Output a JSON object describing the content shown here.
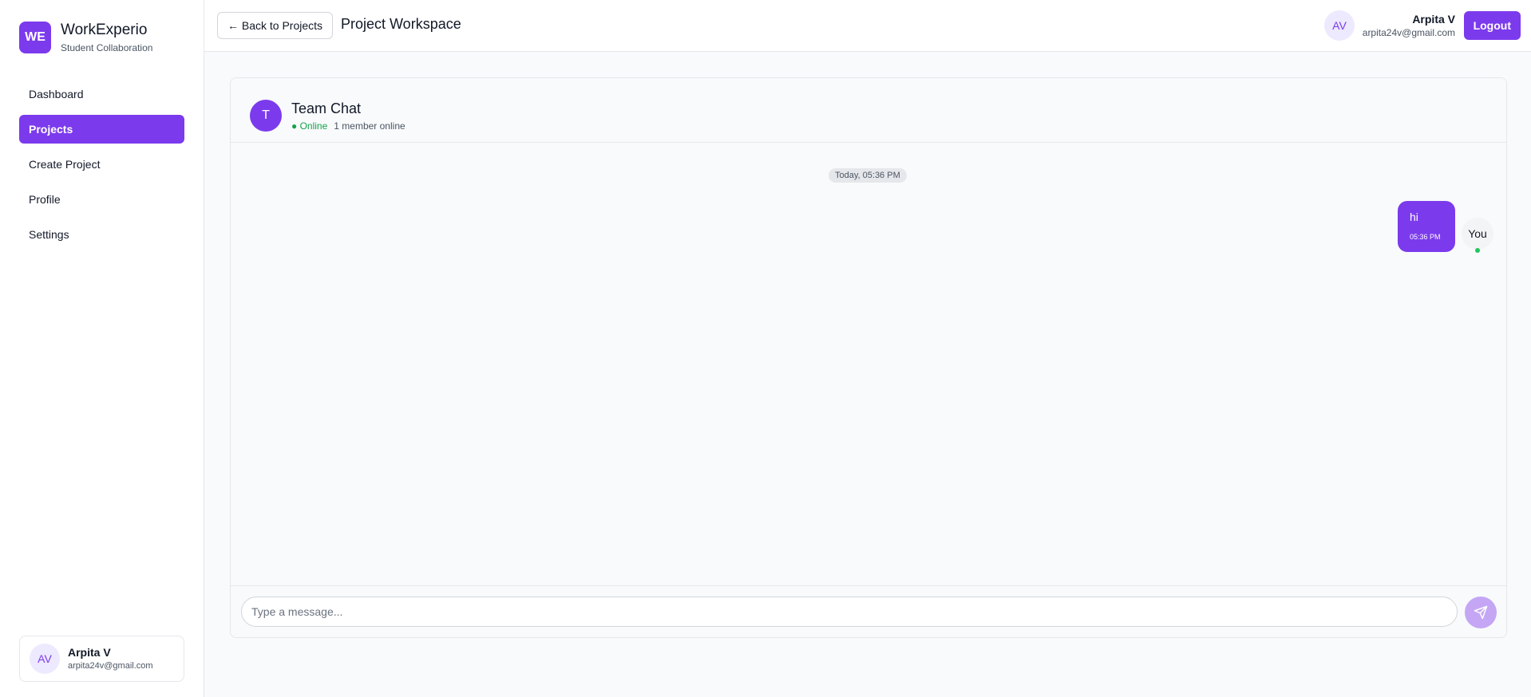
{
  "brand": {
    "logo": "WE",
    "name": "WorkExperio",
    "tagline": "Student Collaboration"
  },
  "sidebar": {
    "items": [
      {
        "label": "Dashboard"
      },
      {
        "label": "Projects"
      },
      {
        "label": "Create Project"
      },
      {
        "label": "Profile"
      },
      {
        "label": "Settings"
      }
    ],
    "active": "Projects"
  },
  "user": {
    "initials": "AV",
    "name": "Arpita V",
    "email": "arpita24v@gmail.com"
  },
  "header": {
    "back_label": "← Back to Projects",
    "title": "Project Workspace",
    "logout_label": "Logout"
  },
  "chat": {
    "avatar": "T",
    "title": "Team Chat",
    "status": "● Online",
    "members_online": "1 member online",
    "date_divider": "Today, 05:36 PM",
    "messages": [
      {
        "text": "hi",
        "time": "05:36 PM",
        "sender": "You"
      }
    ],
    "input_placeholder": "Type a message...",
    "send_icon": "send-icon"
  },
  "colors": {
    "accent": "#7c3aed",
    "online": "#16a34a",
    "send_disabled": "#c4a6f5"
  }
}
